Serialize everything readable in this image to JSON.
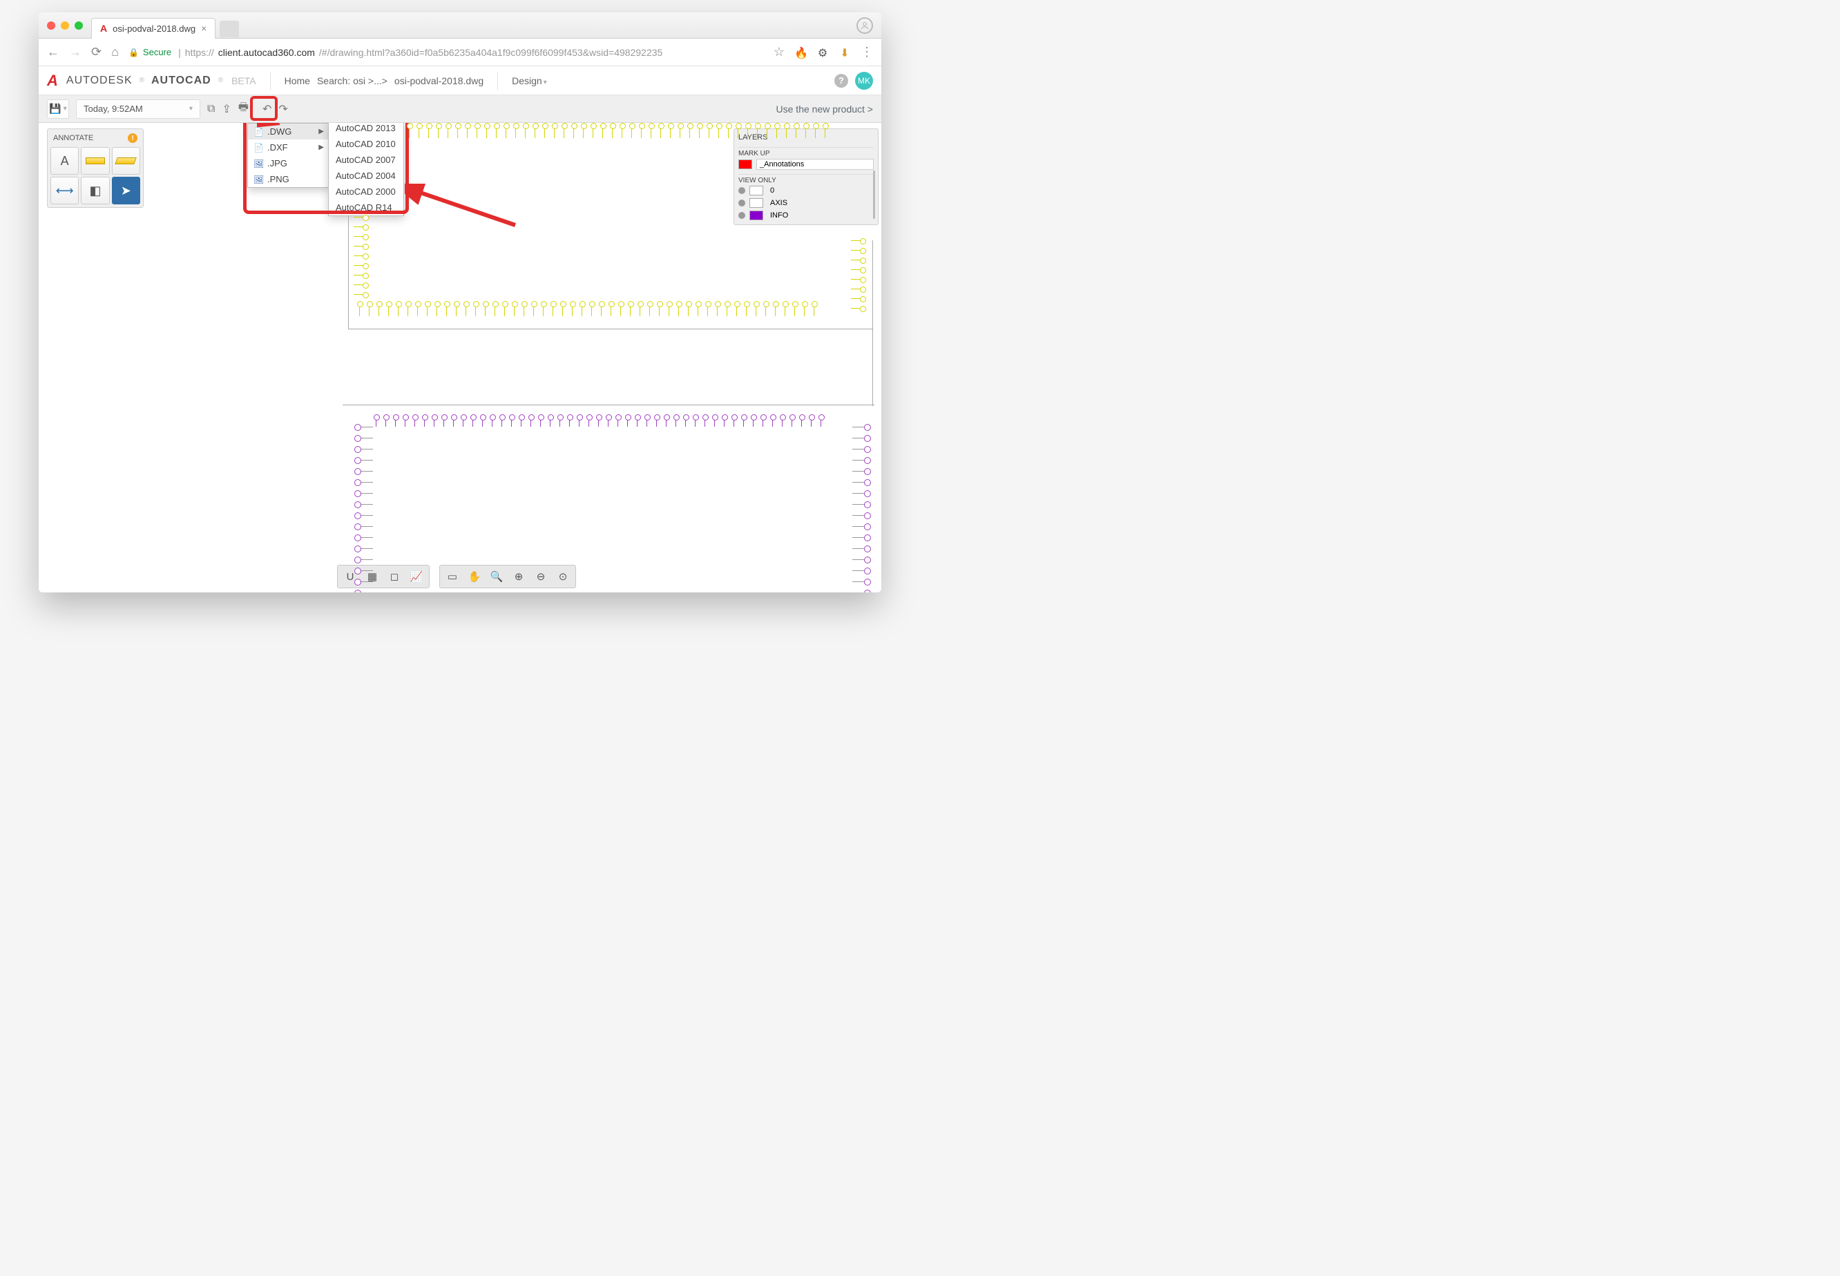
{
  "browser": {
    "tab_title": "osi-podval-2018.dwg",
    "secure_label": "Secure",
    "url_host": "client.autocad360.com",
    "url_prefix": "https://",
    "url_path": "/#/drawing.html?a360id=f0a5b6235a404a1f9c099f6f6099f453&wsid=498292235"
  },
  "header": {
    "brand1": "AUTODESK",
    "brand2": "AUTOCAD",
    "beta": "BETA",
    "crumb_home": "Home",
    "crumb_search": "Search: osi >...>",
    "crumb_file": "osi-podval-2018.dwg",
    "design": "Design",
    "user": "MK"
  },
  "toolbar": {
    "timestamp": "Today, 9:52AM",
    "new_product": "Use the new product >"
  },
  "annotate": {
    "title": "ANNOTATE"
  },
  "export_menu": {
    "items": [
      {
        "label": ".DWG",
        "has_sub": true
      },
      {
        "label": ".DXF",
        "has_sub": true
      },
      {
        "label": ".JPG",
        "has_sub": false
      },
      {
        "label": ".PNG",
        "has_sub": false
      }
    ],
    "submenu": [
      "AutoCAD 2013",
      "AutoCAD 2010",
      "AutoCAD 2007",
      "AutoCAD 2004",
      "AutoCAD 2000",
      "AutoCAD R14"
    ]
  },
  "layers": {
    "title": "LAYERS",
    "markup_label": "MARK UP",
    "annotations": "_Annotations",
    "viewonly_label": "VIEW ONLY",
    "rows": [
      {
        "name": "0",
        "color": "#ffffff"
      },
      {
        "name": "AXIS",
        "color": "#ffffff"
      },
      {
        "name": "INFO",
        "color": "#8800cc"
      }
    ]
  }
}
